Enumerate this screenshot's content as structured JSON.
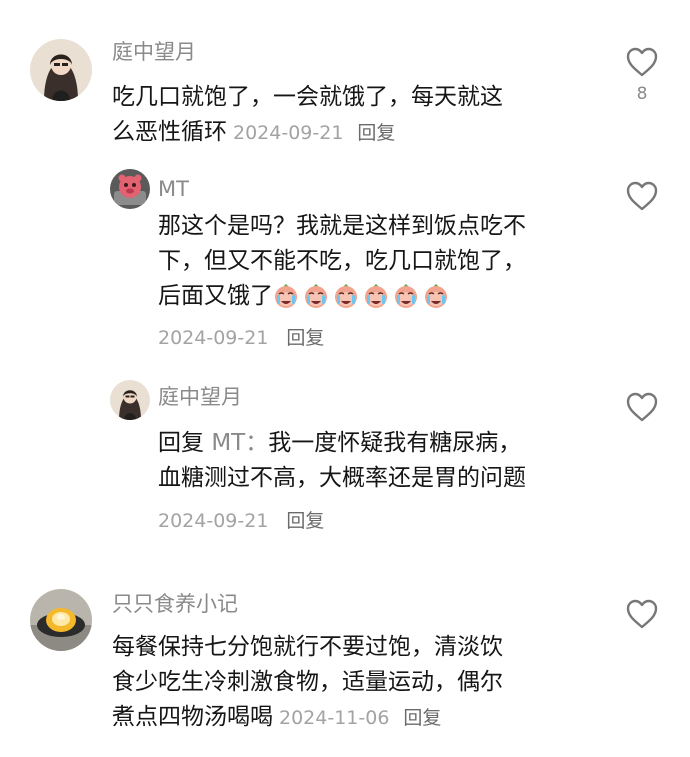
{
  "comments": [
    {
      "user": "庭中望月",
      "text": "吃几口就饱了，一会就饿了，每天就这么恶性循环",
      "text_line1": "吃几口就饱了，一会就饿了，每天就这",
      "text_line2": "么恶性循环",
      "date": "2024-09-21",
      "reply_label": "回复",
      "likes": "8"
    },
    {
      "user": "MT",
      "text_line1": "那这个是吗？我就是这样到饭点吃不",
      "text_line2": "下，但又不能不吃，吃几口就饱了，",
      "text_line3": "后面又饿了",
      "emoji_name": "crying-face",
      "emoji_count": 6,
      "date": "2024-09-21",
      "reply_label": "回复"
    },
    {
      "user": "庭中望月",
      "reply_prefix": "回复",
      "reply_to": "MT：",
      "text_line1": "我一度怀疑我有糖尿病，",
      "text_line2": "血糖测过不高，大概率还是胃的问题",
      "date": "2024-09-21",
      "reply_label": "回复"
    },
    {
      "user": "只只食养小记",
      "text_line1": "每餐保持七分饱就行不要过饱，清淡饮",
      "text_line2": "食少吃生冷刺激食物，适量运动，偶尔",
      "text_line3": "煮点四物汤喝喝",
      "date": "2024-11-06",
      "reply_label": "回复"
    }
  ],
  "icons": {
    "like": "heart-outline-icon"
  },
  "colors": {
    "name": "#8a8a8a",
    "date": "#a3a3a3",
    "text": "#161616",
    "icon": "#777777"
  }
}
